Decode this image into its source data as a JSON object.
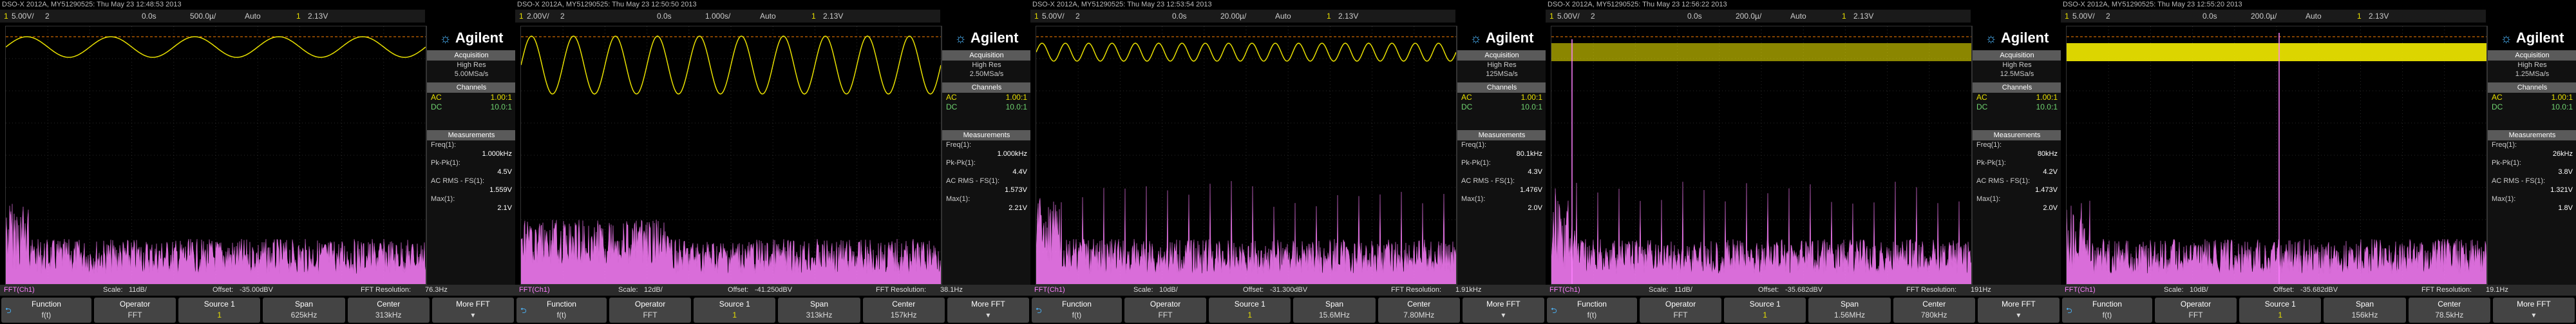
{
  "screens": [
    {
      "title": "DSO-X 2012A, MY51290525: Thu May 23 12:48:53 2013",
      "ch1_scale": "5.00V/",
      "time_pos": "0.0s",
      "time_scale": "500.0µ/",
      "trig_mode": "Auto",
      "trig_level": "2.13V",
      "acq_mode": "High Res",
      "sample_rate": "5.00MSa/s",
      "freq": "1.000kHz",
      "pkpk": "4.5V",
      "acrms": "1.559V",
      "max": "2.1V",
      "fft_scale": "11dB/",
      "offset": "-35.00dBV",
      "resolution": "76.3Hz",
      "span": "625kHz",
      "center": "313kHz",
      "wave_cycles": 5,
      "wave_amp": 16,
      "wave_fill": false
    },
    {
      "title": "DSO-X 2012A, MY51290525: Thu May 23 12:50:50 2013",
      "ch1_scale": "2.00V/",
      "time_pos": "0.0s",
      "time_scale": "1.000s/",
      "trig_mode": "Auto",
      "trig_level": "2.13V",
      "acq_mode": "High Res",
      "sample_rate": "2.50MSa/s",
      "freq": "1.000kHz",
      "pkpk": "4.4V",
      "acrms": "1.573V",
      "max": "2.21V",
      "fft_scale": "12dB/",
      "offset": "-41.250dBV",
      "resolution": "38.1Hz",
      "span": "313kHz",
      "center": "157kHz",
      "wave_cycles": 10,
      "wave_amp": 45,
      "wave_fill": false
    },
    {
      "title": "DSO-X 2012A, MY51290525: Thu May 23 12:53:54 2013",
      "ch1_scale": "5.00V/",
      "time_pos": "0.0s",
      "time_scale": "20.00µ/",
      "trig_mode": "Auto",
      "trig_level": "2.13V",
      "acq_mode": "High Res",
      "sample_rate": "125MSa/s",
      "freq": "80.1kHz",
      "pkpk": "4.3V",
      "acrms": "1.476V",
      "max": "2.0V",
      "fft_scale": "10dB/",
      "offset": "-31.300dBV",
      "resolution": "1.91kHz",
      "span": "15.6MHz",
      "center": "7.80MHz",
      "wave_cycles": 18,
      "wave_amp": 14,
      "wave_fill": false
    },
    {
      "title": "DSO-X 2012A, MY51290525: Thu May 23 12:56:22 2013",
      "ch1_scale": "5.00V/",
      "time_pos": "0.0s",
      "time_scale": "200.0µ/",
      "trig_mode": "Auto",
      "trig_level": "2.13V",
      "acq_mode": "High Res",
      "sample_rate": "12.5MSa/s",
      "freq": "80kHz",
      "pkpk": "4.2V",
      "acrms": "1.473V",
      "max": "2.0V",
      "fft_scale": "11dB/",
      "offset": "-35.682dBV",
      "resolution": "191Hz",
      "span": "1.56MHz",
      "center": "780kHz",
      "wave_cycles": 0,
      "wave_amp": 14,
      "wave_fill": true
    },
    {
      "title": "DSO-X 2012A, MY51290525: Thu May 23 12:55:20 2013",
      "ch1_scale": "5.00V/",
      "time_pos": "0.0s",
      "time_scale": "200.0µ/",
      "trig_mode": "Auto",
      "trig_level": "2.13V",
      "acq_mode": "High Res",
      "sample_rate": "1.25MSa/s",
      "freq": "26kHz",
      "pkpk": "3.8V",
      "acrms": "1.321V",
      "max": "1.8V",
      "fft_scale": "10dB/",
      "offset": "-35.682dBV",
      "resolution": "19.1Hz",
      "span": "156kHz",
      "center": "78.5kHz",
      "wave_cycles": 0,
      "wave_amp": 14,
      "wave_fill": true
    }
  ],
  "labels": {
    "brand": "Agilent",
    "acquisition": "Acquisition",
    "channels": "Channels",
    "measurements": "Measurements",
    "ch_ac": "AC",
    "ch_dc": "DC",
    "ch_ac_val": "1.00:1",
    "ch_dc_val": "10.0:1",
    "freq_label": "Freq(1):",
    "pkpk_label": "Pk-Pk(1):",
    "acrms_label": "AC RMS - FS(1):",
    "max_label": "Max(1):",
    "ch_num": "1",
    "time_ch": "2",
    "trig_ch": "1",
    "fft_label": "FFT(Ch1)",
    "scale_label": "Scale:",
    "offset_label": "Offset:",
    "res_label": "FFT Resolution:",
    "keys": {
      "function": "Function",
      "function_sub": "f(t)",
      "operator": "Operator",
      "operator_sub": "FFT",
      "source": "Source 1",
      "source_sub": "1",
      "span": "Span",
      "center": "Center",
      "more": "More FFT"
    }
  },
  "colors": {
    "ch1": "#e8e000",
    "fft": "#ff80ff",
    "trigger_line": "#ff8000",
    "grid": "#2a2a2a"
  }
}
